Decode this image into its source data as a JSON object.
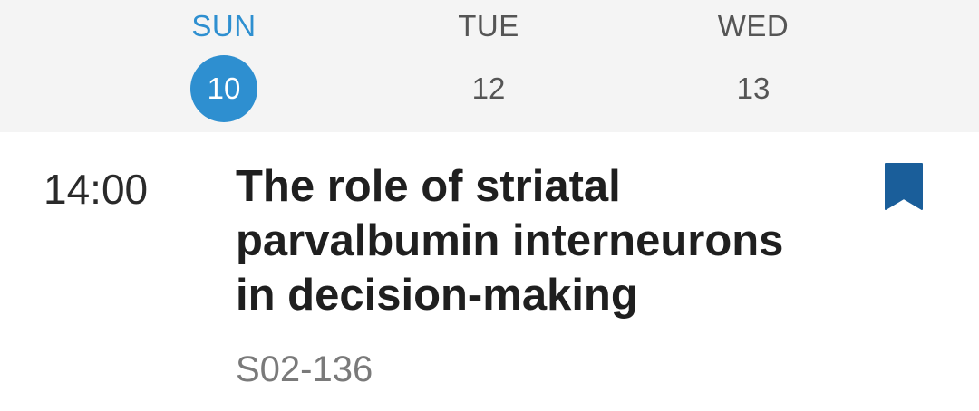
{
  "days": [
    {
      "dow": "SUN",
      "date": "10",
      "selected": true
    },
    {
      "dow": "TUE",
      "date": "12",
      "selected": false
    },
    {
      "dow": "WED",
      "date": "13",
      "selected": false
    }
  ],
  "session": {
    "time": "14:00",
    "title": "The role of striatal parvalbumin interneurons in decision-making",
    "room": "S02-136",
    "bookmark_icon": "bookmark-filled",
    "bookmarked": true
  },
  "colors": {
    "accent": "#2e8fd0",
    "bookmark": "#1a5e9a",
    "header_bg": "#f4f4f4"
  }
}
